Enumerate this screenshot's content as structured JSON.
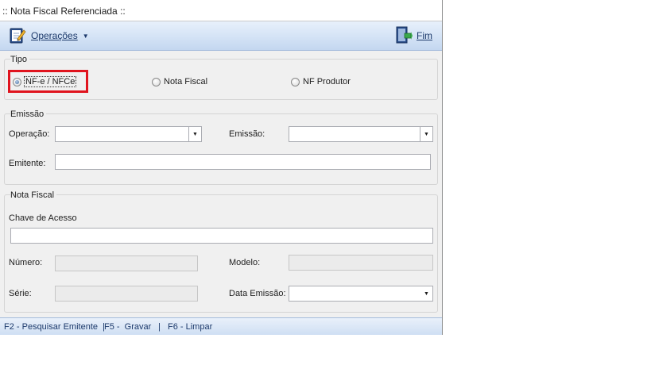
{
  "window": {
    "title": ":: Nota Fiscal Referenciada ::"
  },
  "toolbar": {
    "operacoes_label": "Operações",
    "fim_label": "Fim",
    "operacoes_icon": "notepad-pen-icon",
    "fim_icon": "exit-door-icon"
  },
  "tipo": {
    "title": "Tipo",
    "options": [
      {
        "label": "NF-e / NFCe",
        "checked": true
      },
      {
        "label": "Nota Fiscal",
        "checked": false
      },
      {
        "label": "NF Produtor",
        "checked": false
      }
    ]
  },
  "emissao": {
    "title": "Emissão",
    "operacao_label": "Operação:",
    "operacao_value": "",
    "emissao_label": "Emissão:",
    "emissao_value": "",
    "emitente_label": "Emitente:",
    "emitente_value": ""
  },
  "nota_fiscal": {
    "title": "Nota Fiscal",
    "chave_label": "Chave de Acesso",
    "chave_value": "",
    "numero_label": "Número:",
    "numero_value": "",
    "modelo_label": "Modelo:",
    "modelo_value": "",
    "serie_label": "Série:",
    "serie_value": "",
    "data_emissao_label": "Data Emissão:",
    "data_emissao_value": ""
  },
  "statusbar": {
    "f2": "F2 - Pesquisar Emitente  |",
    "f5": "F5 -  Gravar",
    "sep": "|",
    "f6": "F6 - Limpar"
  },
  "colors": {
    "highlight": "#e0141e",
    "toolbar_text": "#1d3a6b"
  }
}
